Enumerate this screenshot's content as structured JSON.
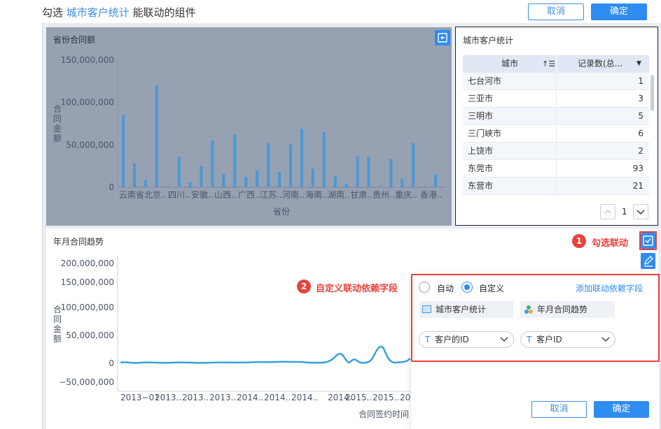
{
  "header": {
    "title_prefix": "勾选",
    "title_highlight": "城市客户统计",
    "title_suffix": "能联动的组件",
    "cancel_label": "取消",
    "confirm_label": "确定"
  },
  "bar_chart": {
    "title": "省份合同额",
    "y_axis_title": "合同金额",
    "x_axis_title": "省份",
    "y_ticks": [
      "150,000,000",
      "100,000,000",
      "50,000,000",
      "0"
    ],
    "x_ticks": [
      "云南省",
      "北京..",
      "四川..",
      "安徽..",
      "山西..",
      "广西..",
      "江苏..",
      "河南..",
      "海南..",
      "湖南..",
      "甘肃..",
      "贵州..",
      "重庆..",
      "香港.."
    ],
    "values": [
      85,
      28,
      9,
      120,
      1,
      36,
      6,
      25,
      55,
      16,
      62,
      12,
      20,
      52,
      18,
      51,
      69,
      22,
      65,
      13,
      4,
      36,
      36,
      1,
      33,
      10,
      52,
      1,
      15
    ],
    "ymax": 150
  },
  "table": {
    "title": "城市客户统计",
    "col_city": "城市",
    "col_count": "记录数(总...",
    "rows": [
      {
        "city": "七台河市",
        "count": "1"
      },
      {
        "city": "三亚市",
        "count": "3"
      },
      {
        "city": "三明市",
        "count": "5"
      },
      {
        "city": "三门峡市",
        "count": "6"
      },
      {
        "city": "上饶市",
        "count": "2"
      },
      {
        "city": "东莞市",
        "count": "93"
      },
      {
        "city": "东营市",
        "count": "21"
      }
    ],
    "page": "1"
  },
  "line_chart": {
    "title": "年月合同趋势",
    "y_axis_title": "合同金额",
    "x_axis_title": "合同签约时间",
    "y_ticks": [
      "200,000,000",
      "150,000,000",
      "100,000,000",
      "50,000,000",
      "0",
      "−50,000,000"
    ],
    "x_ticks": [
      "2013−01",
      "2013..",
      "2013..",
      "2013..",
      "2014..",
      "2014..",
      "2014..",
      "2014..",
      "2015..",
      "2015..",
      "201"
    ]
  },
  "annotations": {
    "step1_num": "1",
    "step1_text": "勾选联动",
    "step2_num": "2",
    "step2_text": "自定义联动依赖字段"
  },
  "popup": {
    "radio_auto": "自动",
    "radio_custom": "自定义",
    "add_link": "添加联动依赖字段",
    "source_chip": "城市客户统计",
    "target_chip": "年月合同趋势",
    "source_field": "客户的ID",
    "target_field": "客户ID",
    "field_type": "T",
    "cancel_label": "取消",
    "confirm_label": "确定"
  },
  "colors": {
    "accent": "#2f8cf0",
    "bar": "#4a98d4",
    "line": "#3aa0da",
    "annotation": "#e8443a"
  }
}
